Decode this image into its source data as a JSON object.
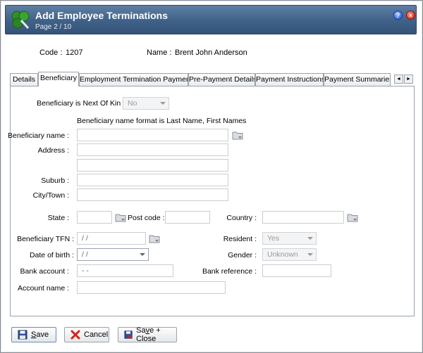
{
  "window": {
    "title": "Add Employee Terminations",
    "subtitle": "Page 2 / 10",
    "help_glyph": "?",
    "close_glyph": "×"
  },
  "employee": {
    "code_label": "Code :",
    "code_value": "1207",
    "name_label": "Name :",
    "name_value": "Brent John Anderson"
  },
  "tabs": [
    {
      "label": "Details"
    },
    {
      "label": "Beneficiary"
    },
    {
      "label": "Employment Termination Payments"
    },
    {
      "label": "Pre-Payment Details"
    },
    {
      "label": "Payment Instructions"
    },
    {
      "label": "Payment Summaries"
    }
  ],
  "tab_scroll": {
    "left": "◄",
    "right": "►"
  },
  "active_tab": "Beneficiary",
  "form": {
    "next_of_kin_label": "Beneficiary is Next Of Kin :",
    "next_of_kin_value": "No",
    "name_format_note": "Beneficiary name format is Last Name, First Names",
    "beneficiary_name_label": "Beneficiary name :",
    "beneficiary_name_value": "",
    "address_label": "Address :",
    "address_line1": "",
    "address_line2": "",
    "suburb_label": "Suburb :",
    "suburb_value": "",
    "city_label": "City/Town :",
    "city_value": "",
    "state_label": "State :",
    "state_value": "",
    "postcode_label": "Post code :",
    "postcode_value": "",
    "country_label": "Country :",
    "country_value": "",
    "tfn_label": "Beneficiary TFN :",
    "tfn_value": "  /  /",
    "resident_label": "Resident :",
    "resident_value": "Yes",
    "dob_label": "Date of birth :",
    "dob_value": " /  /",
    "gender_label": "Gender :",
    "gender_value": "Unknown",
    "bank_account_label": "Bank account :",
    "bank_account_value": " -  -",
    "bank_reference_label": "Bank reference :",
    "bank_reference_value": "",
    "account_name_label": "Account name :",
    "account_name_value": ""
  },
  "buttons": {
    "save_u": "S",
    "save_rest": "ave",
    "cancel": "Cancel",
    "saveclose_pre": "Sa",
    "saveclose_u": "v",
    "saveclose_rest": "e + Close"
  },
  "colors": {
    "titlebar": "#3f6188",
    "accent_blue": "#2456c8",
    "close_red": "#c81e10"
  }
}
